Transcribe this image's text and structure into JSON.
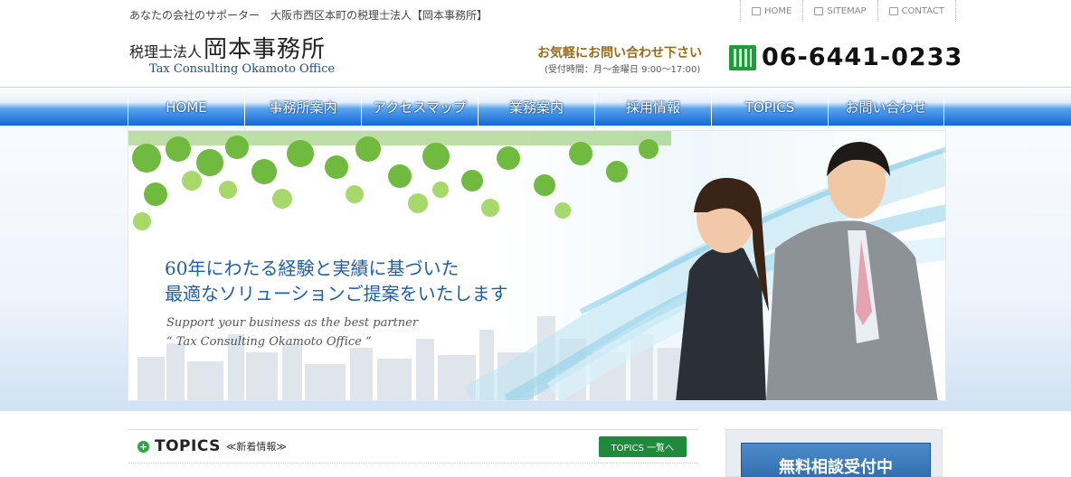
{
  "header": {
    "tagline": "あなたの会社のサポーター　大阪市西区本町の税理士法人【岡本事務所】",
    "logo_prefix": "税理士法人",
    "logo_name": "岡本事務所",
    "logo_en": "Tax Consulting Okamoto Office",
    "contact_title": "お気軽にお問い合わせ下さい",
    "contact_hours": "(受付時間：月～金曜日 9:00～17:00)",
    "phone": "06-6441-0233"
  },
  "util_links": [
    {
      "label": "HOME",
      "icon": "home-icon"
    },
    {
      "label": "SITEMAP",
      "icon": "sitemap-icon"
    },
    {
      "label": "CONTACT",
      "icon": "mail-icon"
    }
  ],
  "nav": [
    "HOME",
    "事務所案内",
    "アクセスマップ",
    "業務案内",
    "採用情報",
    "TOPICS",
    "お問い合わせ"
  ],
  "hero": {
    "headline_1": "60年にわたる経験と実績に基づいた",
    "headline_2": "最適なソリューションご提案をいたします",
    "sub_1": "Support your business as the best partner",
    "sub_2": "“ Tax Consulting Okamoto Office ”"
  },
  "topics": {
    "title": "TOPICS",
    "subtitle": "≪新着情報≫",
    "button": "TOPICS 一覧へ"
  },
  "sidebar": {
    "consult_label": "無料相談受付中"
  },
  "colors": {
    "nav_blue": "#1268d6",
    "accent_green": "#1e8a3c",
    "headline_blue": "#1c5fae",
    "contact_gold": "#9a6a1a"
  }
}
